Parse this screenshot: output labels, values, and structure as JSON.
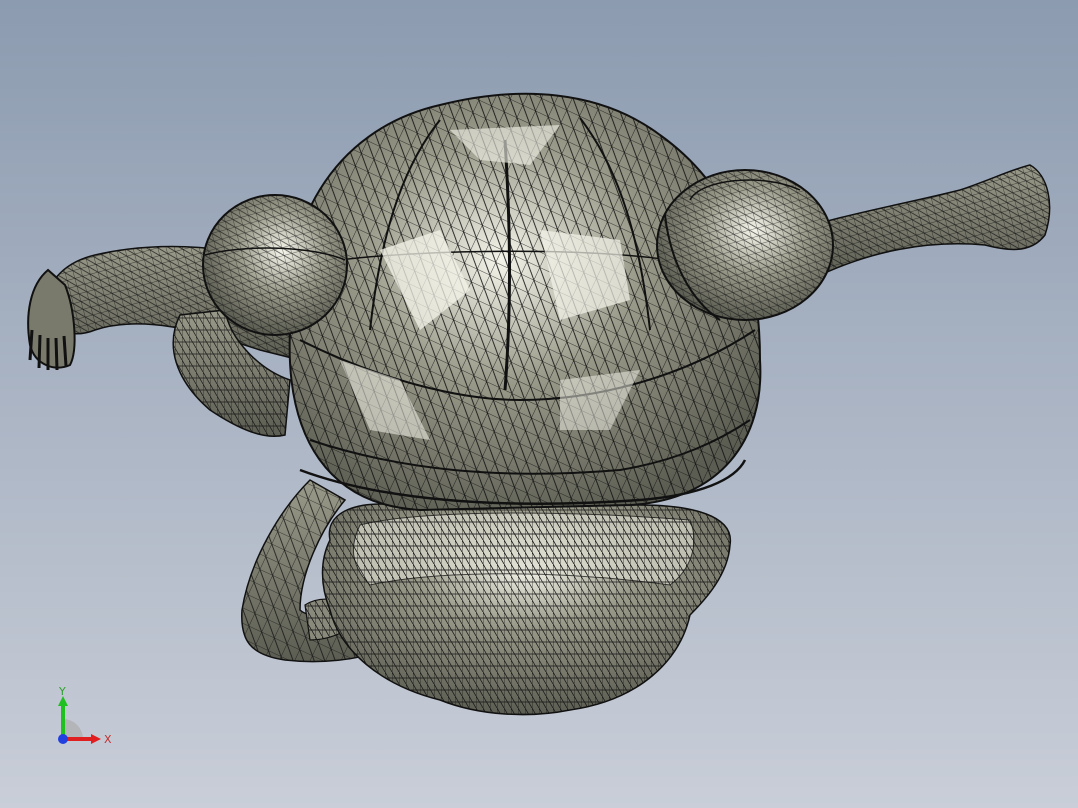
{
  "colors": {
    "background_top": "#8c9bb0",
    "background_bottom": "#c9ced8",
    "model_fill_dark": "#5c5d52",
    "model_fill_mid": "#9a9a8a",
    "model_fill_light": "#f4f4ea",
    "wire": "#111111",
    "axis_x": "#e02020",
    "axis_y": "#20c020",
    "axis_z": "#2040e0",
    "axis_label_x": "#c03030",
    "axis_label_y": "#30a030"
  },
  "triad": {
    "x_label": "X",
    "y_label": "Y"
  }
}
